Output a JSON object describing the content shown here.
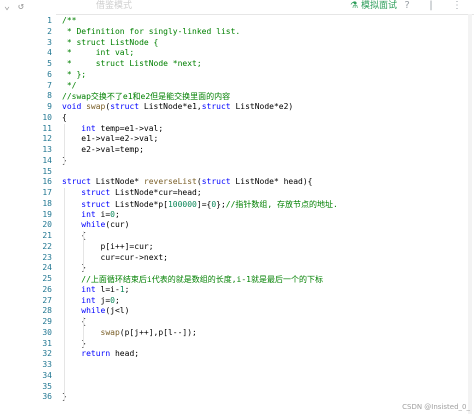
{
  "toolbar": {
    "faded_label": "借鉴模式",
    "test_label": "模拟面试",
    "icons": [
      "play-icon",
      "question-icon",
      "more-icon"
    ]
  },
  "editor": {
    "lines": [
      {
        "n": "1",
        "text": "/**",
        "kind": "com"
      },
      {
        "n": "2",
        "text": " * Definition for singly-linked list.",
        "kind": "com"
      },
      {
        "n": "3",
        "text": " * struct ListNode {",
        "kind": "com"
      },
      {
        "n": "4",
        "text": " *     int val;",
        "kind": "com"
      },
      {
        "n": "5",
        "text": " *     struct ListNode *next;",
        "kind": "com"
      },
      {
        "n": "6",
        "text": " * };",
        "kind": "com"
      },
      {
        "n": "7",
        "text": " */",
        "kind": "com"
      },
      {
        "n": "8",
        "text": "//swap交换不了e1和e2但是能交换里面的内容",
        "kind": "com"
      },
      {
        "n": "9",
        "text": "void swap(struct ListNode*e1,struct ListNode*e2)",
        "kind": "code"
      },
      {
        "n": "10",
        "text": "{",
        "kind": "code"
      },
      {
        "n": "11",
        "text": "    int temp=e1->val;",
        "kind": "code"
      },
      {
        "n": "12",
        "text": "    e1->val=e2->val;",
        "kind": "code"
      },
      {
        "n": "13",
        "text": "    e2->val=temp;",
        "kind": "code"
      },
      {
        "n": "14",
        "text": "}",
        "kind": "code"
      },
      {
        "n": "15",
        "text": "",
        "kind": "code"
      },
      {
        "n": "16",
        "text": "struct ListNode* reverseList(struct ListNode* head){",
        "kind": "code"
      },
      {
        "n": "17",
        "text": "    struct ListNode*cur=head;",
        "kind": "code"
      },
      {
        "n": "18",
        "text": "    struct ListNode*p[100000]={0};//指针数组, 存放节点的地址.",
        "kind": "code"
      },
      {
        "n": "19",
        "text": "    int i=0;",
        "kind": "code"
      },
      {
        "n": "20",
        "text": "    while(cur)",
        "kind": "code"
      },
      {
        "n": "21",
        "text": "    {",
        "kind": "code"
      },
      {
        "n": "22",
        "text": "        p[i++]=cur;",
        "kind": "code"
      },
      {
        "n": "23",
        "text": "        cur=cur->next;",
        "kind": "code"
      },
      {
        "n": "24",
        "text": "    }",
        "kind": "code"
      },
      {
        "n": "25",
        "text": "    //上面循环结束后i代表的就是数组的长度,i-1就是最后一个的下标",
        "kind": "com"
      },
      {
        "n": "26",
        "text": "    int l=i-1;",
        "kind": "code"
      },
      {
        "n": "27",
        "text": "    int j=0;",
        "kind": "code"
      },
      {
        "n": "28",
        "text": "    while(j<l)",
        "kind": "code"
      },
      {
        "n": "29",
        "text": "    {",
        "kind": "code"
      },
      {
        "n": "30",
        "text": "        swap(p[j++],p[l--]);",
        "kind": "code"
      },
      {
        "n": "31",
        "text": "    }",
        "kind": "code"
      },
      {
        "n": "32",
        "text": "    return head;",
        "kind": "code"
      },
      {
        "n": "33",
        "text": "",
        "kind": "code"
      },
      {
        "n": "34",
        "text": "",
        "kind": "code"
      },
      {
        "n": "35",
        "text": "",
        "kind": "code"
      },
      {
        "n": "36",
        "text": "}",
        "kind": "code"
      }
    ]
  },
  "watermark": "CSDN @Insisted_0_",
  "colors": {
    "line_number": "#237893",
    "comment": "#008000",
    "keyword": "#0000ff",
    "number": "#098658",
    "function": "#795e26",
    "accent_green": "#2e9e5b"
  }
}
